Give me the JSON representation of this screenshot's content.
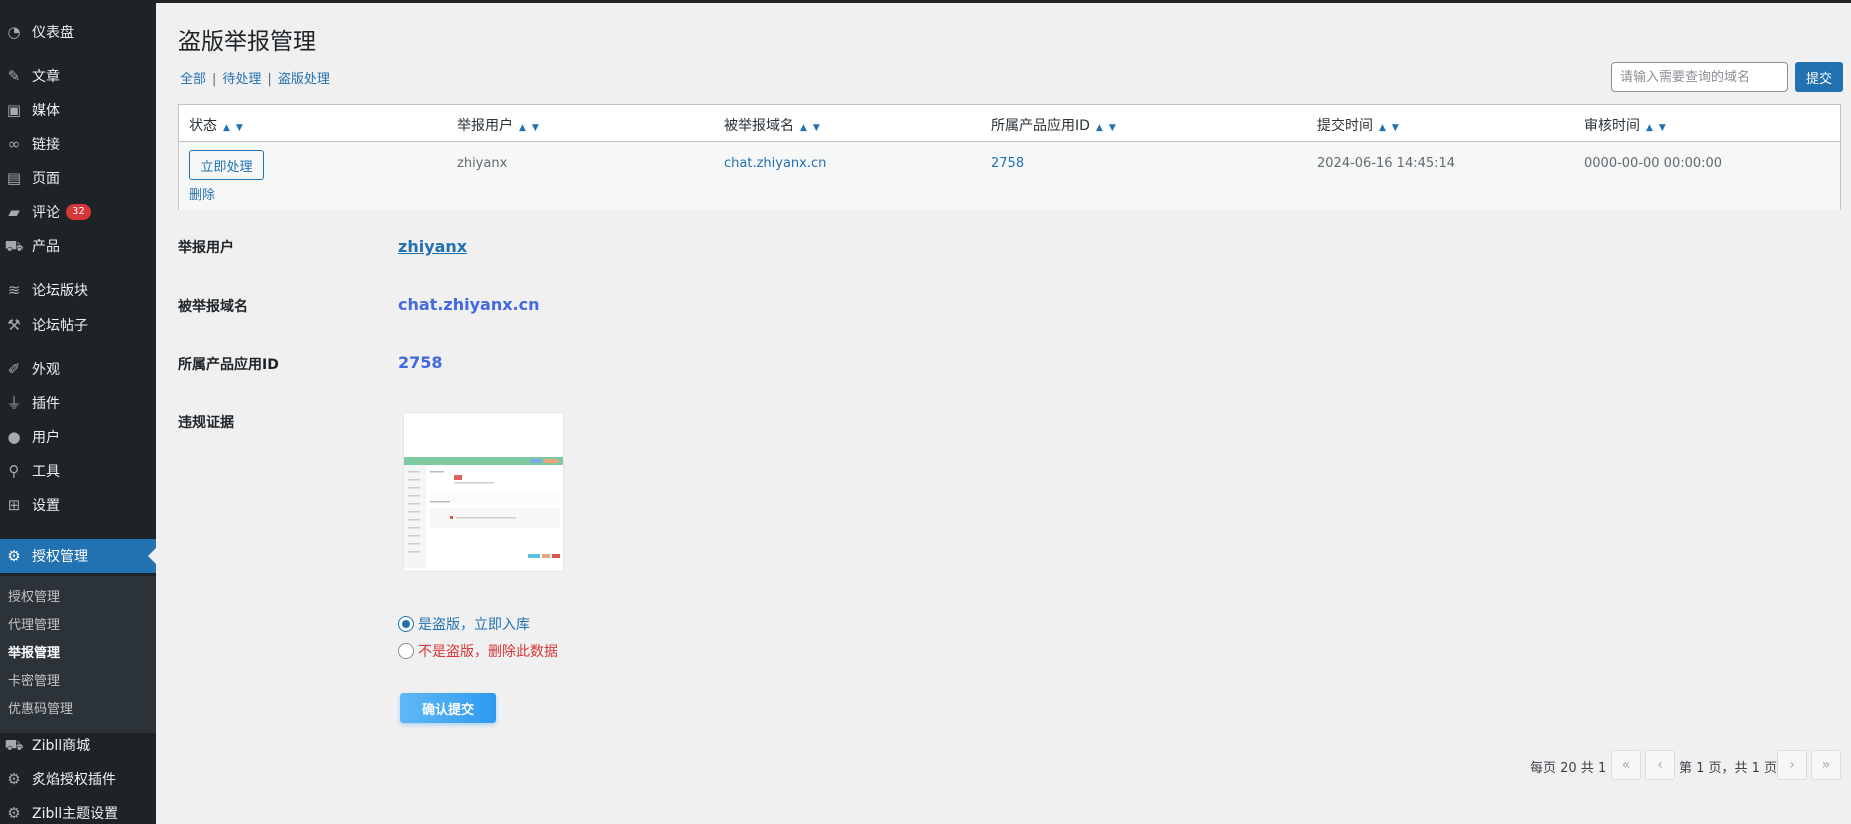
{
  "sidebar": {
    "items": [
      {
        "label": "仪表盘",
        "icon": "dashboard-icon"
      },
      {
        "label": "文章",
        "icon": "pin-icon"
      },
      {
        "label": "媒体",
        "icon": "media-icon"
      },
      {
        "label": "链接",
        "icon": "link-icon"
      },
      {
        "label": "页面",
        "icon": "page-icon"
      },
      {
        "label": "评论",
        "icon": "comment-icon",
        "badge": "32"
      },
      {
        "label": "产品",
        "icon": "cart-icon"
      },
      {
        "label": "论坛版块",
        "icon": "forum-icon"
      },
      {
        "label": "论坛帖子",
        "icon": "forum-posts-icon"
      },
      {
        "label": "外观",
        "icon": "brush-icon"
      },
      {
        "label": "插件",
        "icon": "plugin-icon"
      },
      {
        "label": "用户",
        "icon": "user-icon"
      },
      {
        "label": "工具",
        "icon": "wrench-icon"
      },
      {
        "label": "设置",
        "icon": "settings-icon"
      },
      {
        "label": "授权管理",
        "icon": "gear-icon"
      },
      {
        "label": "Zibll商城",
        "icon": "cart-icon"
      },
      {
        "label": "炙焰授权插件",
        "icon": "gear-icon"
      },
      {
        "label": "Zibll主题设置",
        "icon": "gear-icon"
      }
    ],
    "submenu": [
      "授权管理",
      "代理管理",
      "举报管理",
      "卡密管理",
      "优惠码管理"
    ]
  },
  "page": {
    "title": "盗版举报管理",
    "filters": {
      "all": "全部",
      "pending": "待处理",
      "processed": "盗版处理",
      "sep": "|"
    },
    "search_placeholder": "请输入需要查询的域名",
    "search_submit": "提交"
  },
  "table": {
    "columns": [
      "状态",
      "举报用户",
      "被举报域名",
      "所属产品应用ID",
      "提交时间",
      "审核时间"
    ],
    "sort_up": "▲",
    "sort_down": "▼",
    "row": {
      "action": "立即处理",
      "delete": "删除",
      "user": "zhiyanx",
      "domain": "chat.zhiyanx.cn",
      "app_id": "2758",
      "submit_time": "2024-06-16 14:45:14",
      "review_time": "0000-00-00 00:00:00"
    }
  },
  "detail": {
    "user_label": "举报用户",
    "user_value": "zhiyanx",
    "domain_label": "被举报域名",
    "domain_value": "chat.zhiyanx.cn",
    "appid_label": "所属产品应用ID",
    "appid_value": "2758",
    "evidence_label": "违规证据",
    "options": [
      {
        "label": "是盗版，立即入库",
        "checked": true,
        "color": "#2271b1"
      },
      {
        "label": "不是盗版，删除此数据",
        "checked": false,
        "color": "#d63638"
      }
    ],
    "confirm": "确认提交"
  },
  "pagination": {
    "per_page": "每页 20 共 1",
    "first": "«",
    "prev": "‹",
    "info": "第 1 页，共 1 页",
    "next": "›",
    "last": "»"
  }
}
